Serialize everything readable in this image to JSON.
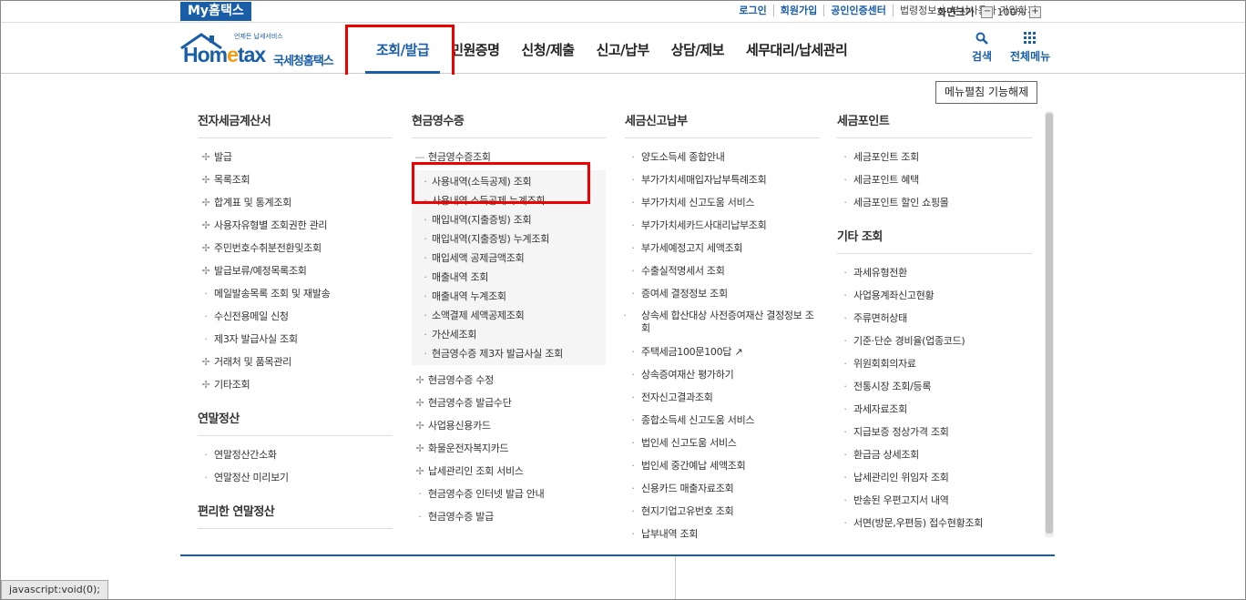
{
  "topbar": {
    "my_hometax": "My홈택스",
    "links": [
      "로그인",
      "회원가입",
      "공인인증센터",
      "법령정보",
      "부서사용자 가입하기"
    ],
    "zoom_label": "화면크기",
    "zoom_minus": "−",
    "zoom_value": "100%",
    "zoom_plus": "+"
  },
  "header": {
    "logo_word_pre": "Hom",
    "logo_word_e": "e",
    "logo_word_post": "tax",
    "logo_tagline": "언제든 납세서비스",
    "logo_korean": "국세청홈택스",
    "gnb": [
      "조회/발급",
      "민원증명",
      "신청/제출",
      "신고/납부",
      "상담/제보",
      "세무대리/납세관리"
    ],
    "search_label": "검색",
    "all_menu_label": "전체메뉴"
  },
  "menu": {
    "close_label": "메뉴펼침 기능해제",
    "col1": {
      "title": "전자세금계산서",
      "items": [
        "발급",
        "목록조회",
        "합계표 및 통계조회",
        "사용자유형별 조회권한 관리",
        "주민번호수취분전환및조회",
        "발급보류/예정목록조회",
        "메일발송목록 조회 및 재발송",
        "수신전용메일 신청",
        "제3자 발급사실 조회",
        "거래처 및 품목관리",
        "기타조회"
      ],
      "section2_title": "연말정산",
      "section2_items": [
        "연말정산간소화",
        "연말정산 미리보기"
      ],
      "section3_title": "편리한 연말정산"
    },
    "col2": {
      "title": "현금영수증",
      "group_title": "현금영수증조회",
      "sub_items": [
        "사용내역(소득공제) 조회",
        "사용내역 소득공제 누계조회",
        "매입내역(지출증빙) 조회",
        "매입내역(지출증빙) 누계조회",
        "매입세액 공제금액조회",
        "매출내역 조회",
        "매출내역 누계조회",
        "소액결제 세액공제조회",
        "가산세조회",
        "현금영수증 제3자 발급사실 조회"
      ],
      "items": [
        "현금영수증 수정",
        "현금영수증 발급수단",
        "사업용신용카드",
        "화물운전자복지카드",
        "납세관리인 조회 서비스",
        "현금영수증 인터넷 발급 안내",
        "현금영수증 발급"
      ]
    },
    "col3": {
      "title": "세금신고납부",
      "items": [
        "양도소득세 종합안내",
        "부가가치세매입자납부특례조회",
        "부가가치세 신고도움 서비스",
        "부가가치세카드사대리납부조회",
        "부가세예정고지 세액조회",
        "수출실적명세서 조회",
        "증여세 결정정보 조회",
        "상속세 합산대상 사전증여재산 결정정보 조회",
        "주택세금100문100답",
        "상속증여재산 평가하기",
        "전자신고결과조회",
        "종합소득세 신고도움 서비스",
        "법인세 신고도움 서비스",
        "법인세 중간예납 세액조회",
        "신용카드 매출자료조회",
        "현지기업고유번호 조회",
        "납부내역 조회"
      ]
    },
    "col4": {
      "title": "세금포인트",
      "items": [
        "세금포인트 조회",
        "세금포인트 혜택",
        "세금포인트 할인 쇼핑몰"
      ],
      "section2_title": "기타 조회",
      "section2_items": [
        "과세유형전환",
        "사업용계좌신고현황",
        "주류면허상태",
        "기준·단순 경비율(업종코드)",
        "위원회회의자료",
        "전통시장 조회/등록",
        "과세자료조회",
        "지급보증 정상가격 조회",
        "환급금 상세조회",
        "납세관리인 위임자 조회",
        "반송된 우편고지서 내역",
        "서면(방문,우편등) 접수현황조회"
      ]
    }
  },
  "status_bar": "javascript:void(0);"
}
